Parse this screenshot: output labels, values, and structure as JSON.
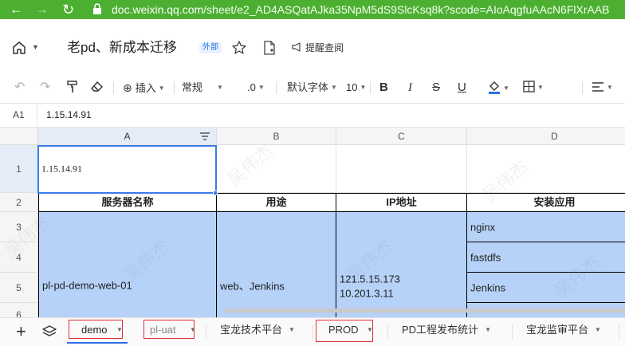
{
  "browser": {
    "url_prefix": "doc.weixin.qq.com",
    "url_rest": "/sheet/e2_AD4ASQatAJka35NpM5dS9SlcKsq8k?scode=AIoAqgfuAAcN6FlXrAAB",
    "back_icon": "arrow-left-icon",
    "forward_icon": "arrow-right-icon",
    "refresh_icon": "refresh-icon",
    "lock_icon": "lock-icon"
  },
  "doc": {
    "title": "老pd、新成本迁移",
    "tag": "外部",
    "remind_label": "提醒查阅"
  },
  "toolbar": {
    "insert_label": "插入",
    "format_label": "常规",
    "decimal_label": ".0",
    "font_label": "默认字体",
    "size_label": "10",
    "bold_label": "B",
    "italic_label": "I",
    "strike_label": "S",
    "underline_label": "U",
    "fill_color": "#2f6fe4"
  },
  "formula_bar": {
    "cell_ref": "A1",
    "value": "1.15.14.91"
  },
  "sheet": {
    "columns": [
      "A",
      "B",
      "C",
      "D"
    ],
    "rows": [
      "1",
      "2",
      "3",
      "4",
      "5",
      "6"
    ],
    "a1_value": "1.15.14.91",
    "headers": {
      "server_name": "服务器名称",
      "purpose": "用途",
      "ip": "IP地址",
      "apps": "安装应用"
    },
    "record": {
      "server_name": "pl-pd-demo-web-01",
      "purpose": "web、Jenkins",
      "ip_line1": "121.5.15.173",
      "ip_line2": "10.201.3.11",
      "apps": [
        "nginx",
        "fastdfs",
        "Jenkins"
      ]
    },
    "accent_color": "#b6d2f8",
    "watermark": "吴伟杰 Evan Wu"
  },
  "tabs": [
    {
      "label": "demo",
      "active": true,
      "boxed": true
    },
    {
      "label": "pl-uat",
      "active": false,
      "boxed": true
    },
    {
      "label": "宝龙技术平台",
      "active": false,
      "boxed": false
    },
    {
      "label": "PROD",
      "active": false,
      "boxed": true
    },
    {
      "label": "PD工程发布统计",
      "active": false,
      "boxed": false
    },
    {
      "label": "宝龙监审平台",
      "active": false,
      "boxed": false
    }
  ]
}
